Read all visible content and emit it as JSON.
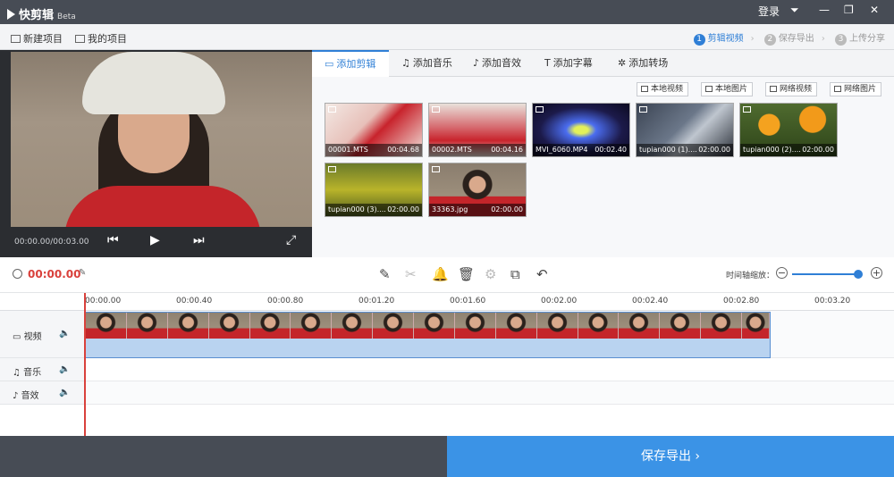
{
  "app": {
    "title": "快剪辑",
    "beta": "Beta"
  },
  "titlebar": {
    "login": "登录",
    "menu_icon": "menu-icon",
    "min": "—",
    "max": "❐",
    "close": "✕"
  },
  "toolbar": {
    "new_project": "新建项目",
    "my_projects": "我的项目"
  },
  "steps": [
    {
      "num": "1",
      "label": "剪辑视频",
      "active": true
    },
    {
      "num": "2",
      "label": "保存导出",
      "active": false
    },
    {
      "num": "3",
      "label": "上传分享",
      "active": false
    }
  ],
  "preview": {
    "timecode": "00:00.00/00:03.00"
  },
  "tabs": [
    {
      "label": "添加剪辑",
      "icon": "video-icon",
      "active": true
    },
    {
      "label": "添加音乐",
      "icon": "music-icon",
      "active": false
    },
    {
      "label": "添加音效",
      "icon": "sound-effect-icon",
      "active": false
    },
    {
      "label": "添加字幕",
      "icon": "text-icon",
      "active": false
    },
    {
      "label": "添加转场",
      "icon": "transition-icon",
      "active": false
    }
  ],
  "sources": [
    "本地视频",
    "本地图片",
    "网络视频",
    "网络图片"
  ],
  "media": [
    {
      "name": "00001.MTS",
      "duration": "00:04.68",
      "kind": "video"
    },
    {
      "name": "00002.MTS",
      "duration": "00:04.16",
      "kind": "video"
    },
    {
      "name": "MVI_6060.MP4",
      "duration": "00:02.40",
      "kind": "video"
    },
    {
      "name": "tupian000 (1)....",
      "duration": "02:00.00",
      "kind": "image"
    },
    {
      "name": "tupian000 (2)....",
      "duration": "02:00.00",
      "kind": "image"
    },
    {
      "name": "tupian000 (3)....",
      "duration": "02:00.00",
      "kind": "image"
    },
    {
      "name": "33363.jpg",
      "duration": "02:00.00",
      "kind": "image"
    }
  ],
  "editor": {
    "current_time": "00:00.00",
    "zoom_label": "时间轴缩放：",
    "zoom_level": 0.92
  },
  "ruler": [
    "00:00.00",
    "00:00.40",
    "00:00.80",
    "00:01.20",
    "00:01.60",
    "00:02.00",
    "00:02.40",
    "00:02.80",
    "00:03.20"
  ],
  "tracks": {
    "video": "视频",
    "music": "音乐",
    "effects": "音效"
  },
  "footer": {
    "save": "保存导出 ›"
  },
  "colors": {
    "accent": "#2f7fd6",
    "playhead": "#d9413c",
    "titlebar": "#474c55"
  }
}
